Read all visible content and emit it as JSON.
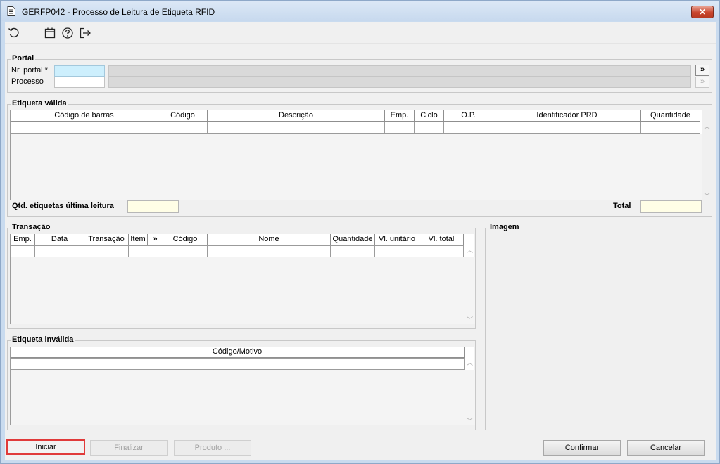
{
  "window": {
    "title": "GERFP042 - Processo de Leitura de Etiqueta RFID",
    "close_label": "✕"
  },
  "toolbar": {
    "icons": [
      "refresh-icon",
      "calendar-icon",
      "help-icon",
      "exit-icon"
    ]
  },
  "portal": {
    "group_label": "Portal",
    "nr_portal_label": "Nr. portal *",
    "nr_portal_value": "",
    "processo_label": "Processo",
    "processo_value": "",
    "lookup_label": "»",
    "lookup_disabled_label": "»"
  },
  "etiqueta_valida": {
    "group_label": "Etiqueta válida",
    "columns": [
      "Código de barras",
      "Código",
      "Descrição",
      "Emp.",
      "Ciclo",
      "O.P.",
      "Identificador PRD",
      "Quantidade"
    ],
    "qtd_label": "Qtd. etiquetas última leitura",
    "qtd_value": "",
    "total_label": "Total",
    "total_value": ""
  },
  "transacao": {
    "group_label": "Transação",
    "columns": [
      "Emp.",
      "Data",
      "Transação",
      "Item",
      "»",
      "Código",
      "Nome",
      "Quantidade",
      "Vl. unitário",
      "Vl. total"
    ]
  },
  "etiqueta_invalida": {
    "group_label": "Etiqueta inválida",
    "columns": [
      "Código/Motivo"
    ]
  },
  "imagem": {
    "group_label": "Imagem"
  },
  "buttons": {
    "iniciar": "Iniciar",
    "finalizar": "Finalizar",
    "produto": "Produto ...",
    "confirmar": "Confirmar",
    "cancelar": "Cancelar"
  },
  "colors": {
    "active_input": "#cdeffd",
    "yellow_input": "#fffee6",
    "focus_border": "#e03a3a",
    "title_gradient_top": "#dce8f6"
  }
}
